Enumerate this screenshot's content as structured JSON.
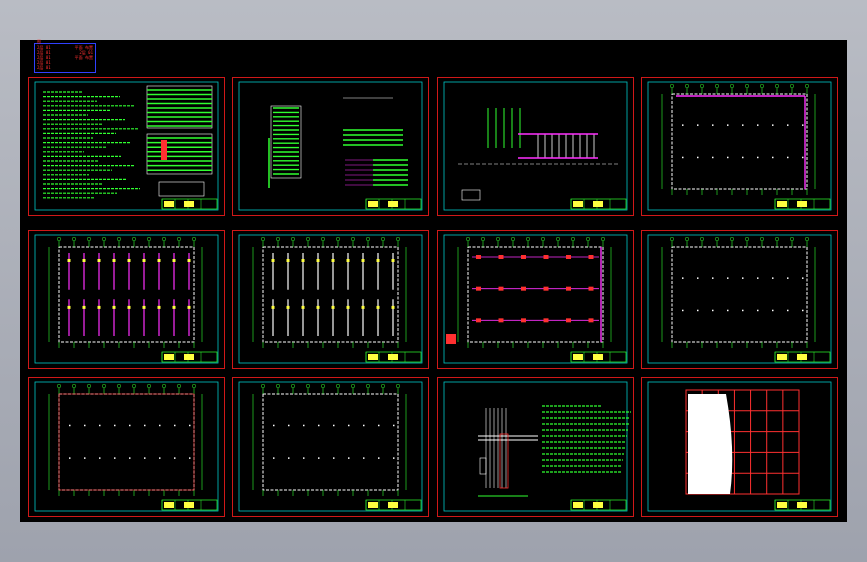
{
  "app": {
    "title_marker": "图",
    "legend_rows": [
      [
        "2层 01",
        "平面 布置"
      ],
      [
        "2层 01",
        "2层 01"
      ],
      [
        "2层 01",
        "平面 布置"
      ],
      [
        "2层 01",
        ""
      ],
      [
        "2层 01",
        ""
      ]
    ]
  },
  "colors": {
    "background": "#000000",
    "sheet_border": "#d01818",
    "drawing_frame": "#00c8c8",
    "line_white": "#ffffff",
    "line_magenta": "#ff30ff",
    "line_green": "#30ff30",
    "line_red": "#ff3030",
    "line_yellow": "#ffff40"
  },
  "sheets": [
    {
      "kind": "notes"
    },
    {
      "kind": "schematic"
    },
    {
      "kind": "riser"
    },
    {
      "kind": "plan-outline"
    },
    {
      "kind": "plan-lighting"
    },
    {
      "kind": "plan-lighting-2"
    },
    {
      "kind": "plan-sockets"
    },
    {
      "kind": "plan-outline"
    },
    {
      "kind": "plan-outline-2"
    },
    {
      "kind": "plan-grid"
    },
    {
      "kind": "detail"
    },
    {
      "kind": "grid-red"
    }
  ]
}
